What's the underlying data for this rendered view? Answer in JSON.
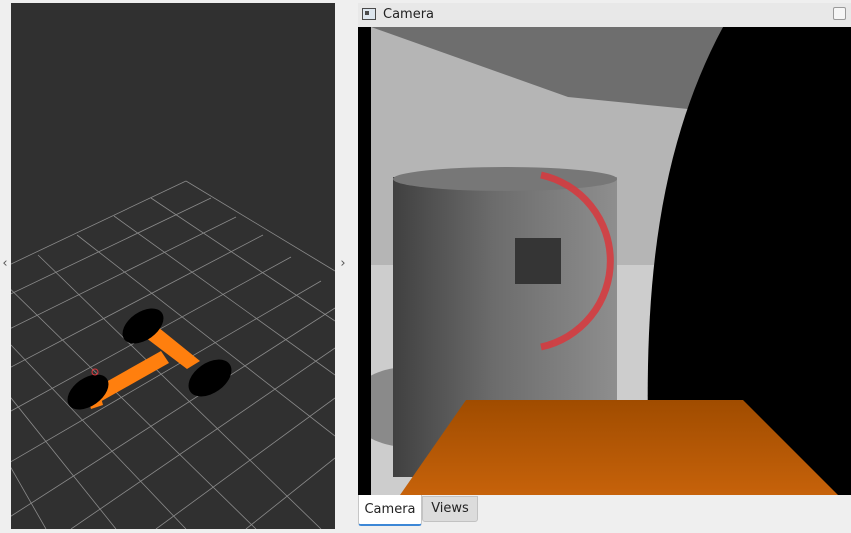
{
  "left_panel": {
    "collapse_left_glyph": "‹",
    "collapse_right_glyph": "›"
  },
  "camera_panel": {
    "title": "Camera",
    "title_icon": "panel-camera-icon",
    "float_button_icon": "undock-square-icon"
  },
  "tabs": [
    {
      "label": "Camera",
      "active": true
    },
    {
      "label": "Views",
      "active": false
    }
  ],
  "colors": {
    "viewport_bg": "#303030",
    "grid": "#8a8a8a",
    "robot_body": "#ff7f0e",
    "wheels": "#000000",
    "camera_floor": "#c65d00",
    "marker_arc": "#d9373c",
    "active_tab_accent": "#3c87d6"
  }
}
